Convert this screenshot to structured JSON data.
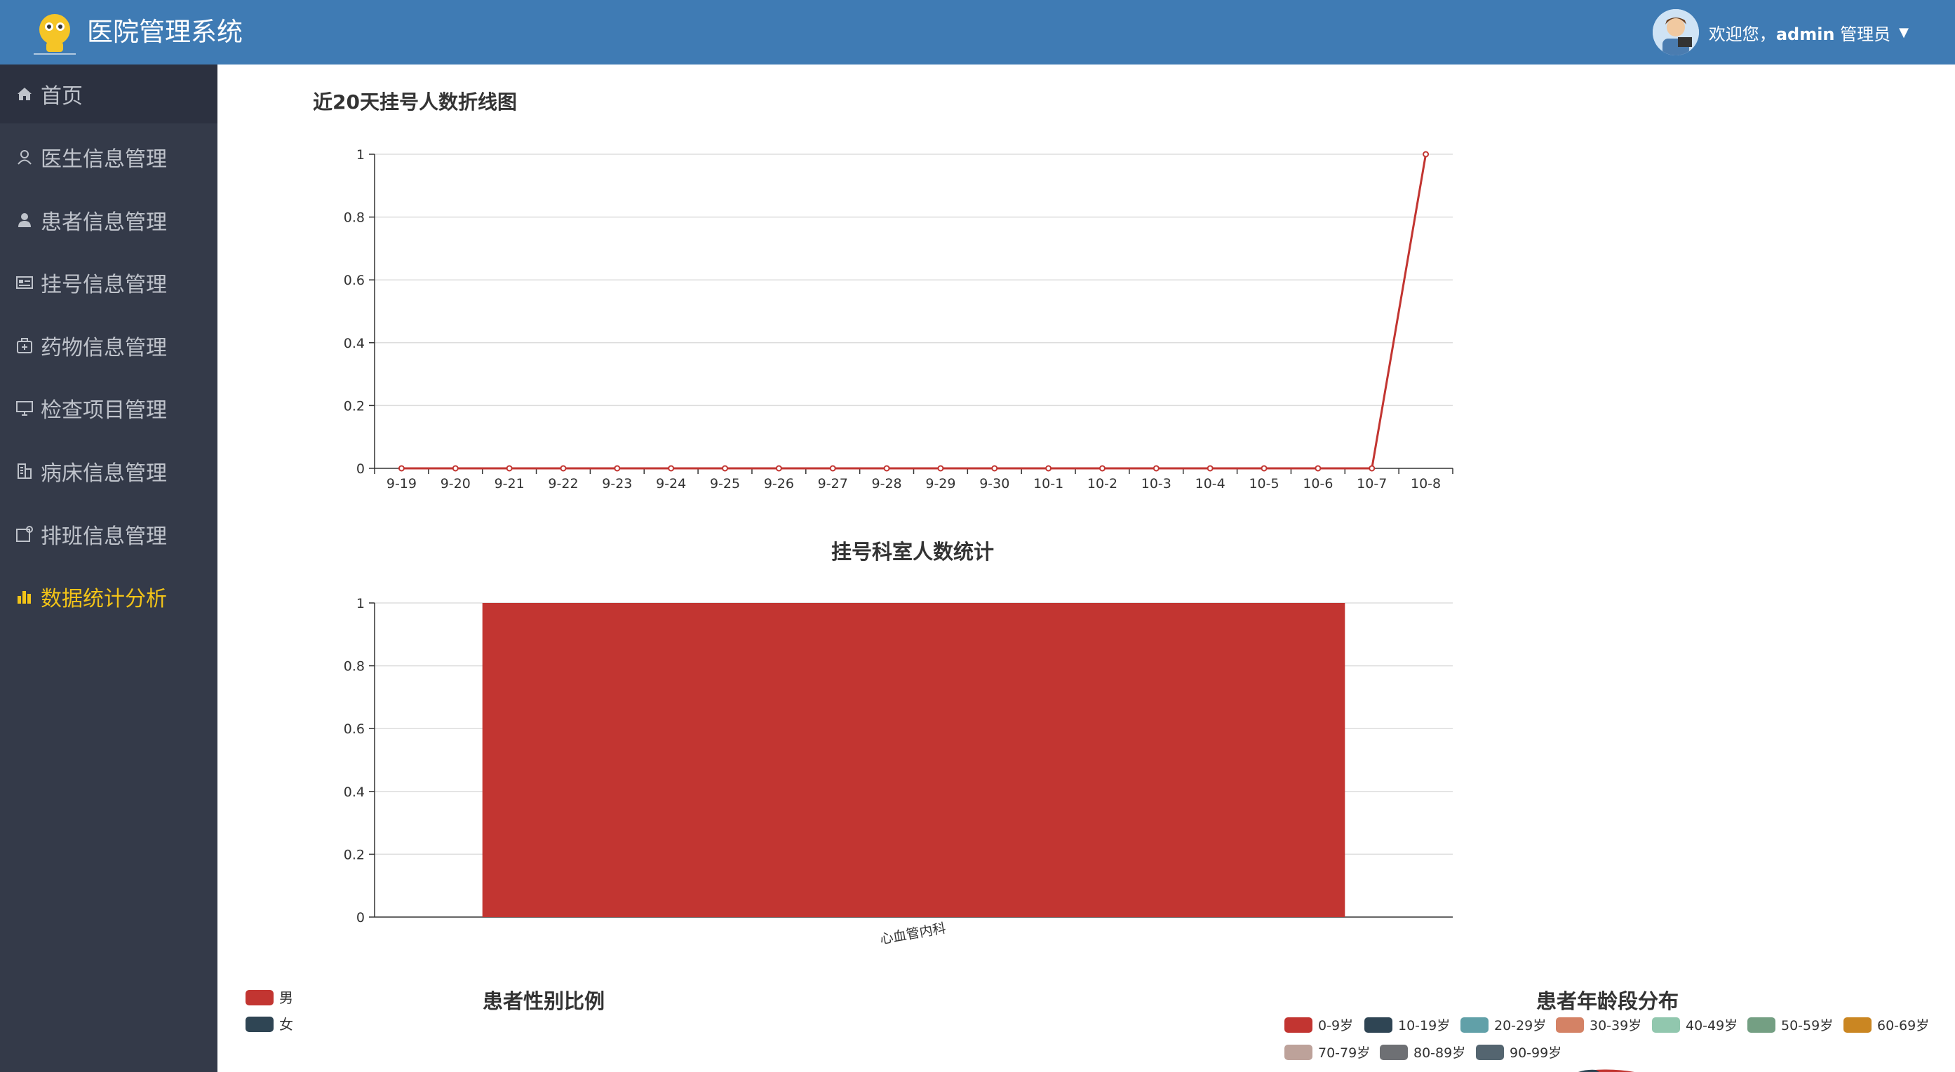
{
  "header": {
    "app_title": "医院管理系统",
    "welcome": "欢迎您，",
    "username": "admin",
    "role": "管理员"
  },
  "sidebar": {
    "items": [
      {
        "label": "首页",
        "icon": "home-icon"
      },
      {
        "label": "医生信息管理",
        "icon": "user-outline-icon"
      },
      {
        "label": "患者信息管理",
        "icon": "user-filled-icon"
      },
      {
        "label": "挂号信息管理",
        "icon": "id-card-icon"
      },
      {
        "label": "药物信息管理",
        "icon": "medicine-box-icon"
      },
      {
        "label": "检查项目管理",
        "icon": "monitor-icon"
      },
      {
        "label": "病床信息管理",
        "icon": "building-icon"
      },
      {
        "label": "排班信息管理",
        "icon": "calendar-edit-icon"
      },
      {
        "label": "数据统计分析",
        "icon": "bar-chart-icon"
      }
    ],
    "active_index": 8
  },
  "colors": {
    "header": "#3f7bb4",
    "sidebar": "#343a49",
    "active": "#f2c318",
    "series": "#c23531"
  },
  "chart_data": [
    {
      "type": "line",
      "title": "近20天挂号人数折线图",
      "x": [
        "9-19",
        "9-20",
        "9-21",
        "9-22",
        "9-23",
        "9-24",
        "9-25",
        "9-26",
        "9-27",
        "9-28",
        "9-29",
        "9-30",
        "10-1",
        "10-2",
        "10-3",
        "10-4",
        "10-5",
        "10-6",
        "10-7",
        "10-8"
      ],
      "y": [
        0,
        0,
        0,
        0,
        0,
        0,
        0,
        0,
        0,
        0,
        0,
        0,
        0,
        0,
        0,
        0,
        0,
        0,
        0,
        1
      ],
      "yticks": [
        "0",
        "0.2",
        "0.4",
        "0.6",
        "0.8",
        "1"
      ],
      "ylim": [
        0,
        1
      ],
      "grid": true
    },
    {
      "type": "bar",
      "title": "挂号科室人数统计",
      "categories": [
        "心血管内科"
      ],
      "values": [
        1
      ],
      "yticks": [
        "0",
        "0.2",
        "0.4",
        "0.6",
        "0.8",
        "1"
      ],
      "ylim": [
        0,
        1
      ],
      "grid": true
    },
    {
      "type": "pie",
      "title": "患者性别比例",
      "legend": [
        "男",
        "女"
      ],
      "legend_colors": [
        "#c23531",
        "#2f4554"
      ],
      "legend_position": "top-left"
    },
    {
      "type": "pie",
      "title": "患者年龄段分布",
      "legend": [
        "0-9岁",
        "10-19岁",
        "20-29岁",
        "30-39岁",
        "40-49岁",
        "50-59岁",
        "60-69岁",
        "70-79岁",
        "80-89岁",
        "90-99岁"
      ],
      "legend_colors": [
        "#c23531",
        "#2f4554",
        "#61a0a8",
        "#d48265",
        "#91c7ae",
        "#749f83",
        "#ca8622",
        "#bda29a",
        "#6e7074",
        "#546570"
      ],
      "legend_position": "top"
    }
  ]
}
